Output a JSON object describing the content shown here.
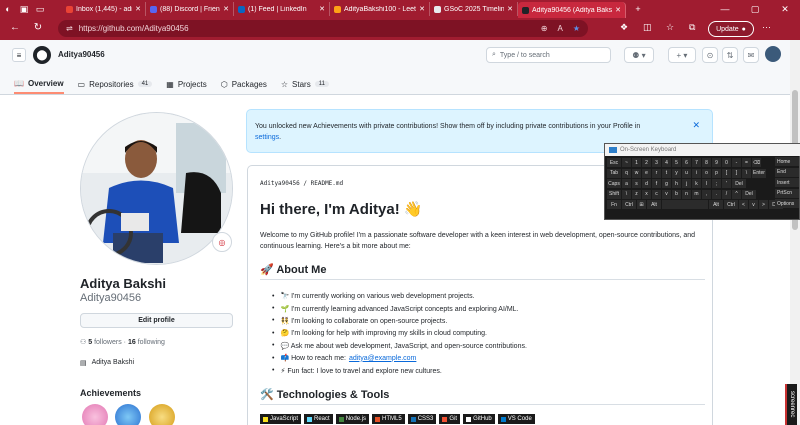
{
  "browser": {
    "tabs": [
      {
        "title": "Inbox (1,445) - adityabaks",
        "color": "#ea4335"
      },
      {
        "title": "(88) Discord | Friends",
        "color": "#5865f2"
      },
      {
        "title": "(1) Feed | LinkedIn",
        "color": "#0a66c2"
      },
      {
        "title": "AdityaBakshi100 - LeetCo",
        "color": "#ffa116"
      },
      {
        "title": "GSoC 2025 Timeline",
        "color": "#e8eaed"
      },
      {
        "title": "Aditya90456 (Aditya Baks",
        "color": "#1f2328"
      }
    ],
    "url": "https://github.com/Aditya90456",
    "update_label": "Update"
  },
  "github": {
    "username": "Aditya90456",
    "search_placeholder": "Type / to search",
    "search_key": "/",
    "tabs": [
      {
        "label": "Overview",
        "count": "",
        "icon": "book-open-icon"
      },
      {
        "label": "Repositories",
        "count": "41",
        "icon": "repo-icon"
      },
      {
        "label": "Projects",
        "count": "",
        "icon": "table-icon"
      },
      {
        "label": "Packages",
        "count": "",
        "icon": "package-icon"
      },
      {
        "label": "Stars",
        "count": "11",
        "icon": "star-icon"
      }
    ]
  },
  "profile": {
    "full_name": "Aditya Bakshi",
    "login": "Aditya90456",
    "edit_label": "Edit profile",
    "followers": "5",
    "followers_label": "followers",
    "following": "16",
    "following_label": "following",
    "org": "Aditya Bakshi",
    "achievements_label": "Achievements"
  },
  "banner": {
    "text": "You unlocked new Achievements with private contributions! Show them off by including private contributions in your Profile in",
    "link": "settings",
    "end": "."
  },
  "readme": {
    "path_user": "Aditya90456",
    "path_sep": "/",
    "path_file": "README.md",
    "heading": "Hi there, I'm Aditya! 👋",
    "intro": "Welcome to my GitHub profile! I'm a passionate software developer with a keen interest in web development, open-source contributions, and continuous learning. Here's a bit more about me:",
    "about_heading": "🚀 About Me",
    "about_items": [
      "🔭 I'm currently working on various web development projects.",
      "🌱 I'm currently learning advanced JavaScript concepts and exploring AI/ML.",
      "👯 I'm looking to collaborate on open-source projects.",
      "🤔 I'm looking for help with improving my skills in cloud computing.",
      "💬 Ask me about web development, JavaScript, and open-source contributions.",
      "📫 How to reach me:",
      "⚡ Fun fact: I love to travel and explore new cultures."
    ],
    "email": "aditya@example.com",
    "tech_heading": "🛠️ Technologies & Tools",
    "tech": [
      {
        "label": "JavaScript",
        "color": "#f7df1e"
      },
      {
        "label": "React",
        "color": "#61dafb"
      },
      {
        "label": "Node.js",
        "color": "#43853d"
      },
      {
        "label": "HTML5",
        "color": "#e34f26"
      },
      {
        "label": "CSS3",
        "color": "#1572b6"
      },
      {
        "label": "Git",
        "color": "#f05032"
      },
      {
        "label": "GitHub",
        "color": "#ffffff"
      },
      {
        "label": "VS Code",
        "color": "#007acc"
      }
    ]
  },
  "osk": {
    "title": "On-Screen Keyboard",
    "side_keys": [
      "Home",
      "End",
      "Insert",
      "PrtScn",
      "Options"
    ],
    "rows": [
      [
        "Esc",
        "~",
        "1",
        "2",
        "3",
        "4",
        "5",
        "6",
        "7",
        "8",
        "9",
        "0",
        "-",
        "=",
        "⌫"
      ],
      [
        "Tab",
        "q",
        "w",
        "e",
        "r",
        "t",
        "y",
        "u",
        "i",
        "o",
        "p",
        "[",
        "]",
        "\\",
        "Enter"
      ],
      [
        "Caps",
        "a",
        "s",
        "d",
        "f",
        "g",
        "h",
        "j",
        "k",
        "l",
        ";",
        "'",
        "Del"
      ],
      [
        "Shift",
        "\\",
        "z",
        "x",
        "c",
        "v",
        "b",
        "n",
        "m",
        ",",
        ".",
        "/",
        "^",
        "Del"
      ],
      [
        "Fn",
        "Ctrl",
        "⊞",
        "Alt",
        "",
        "Alt",
        "Ctrl",
        "<",
        "v",
        ">",
        "Del"
      ]
    ]
  },
  "taskbar_tab": "screenrec"
}
